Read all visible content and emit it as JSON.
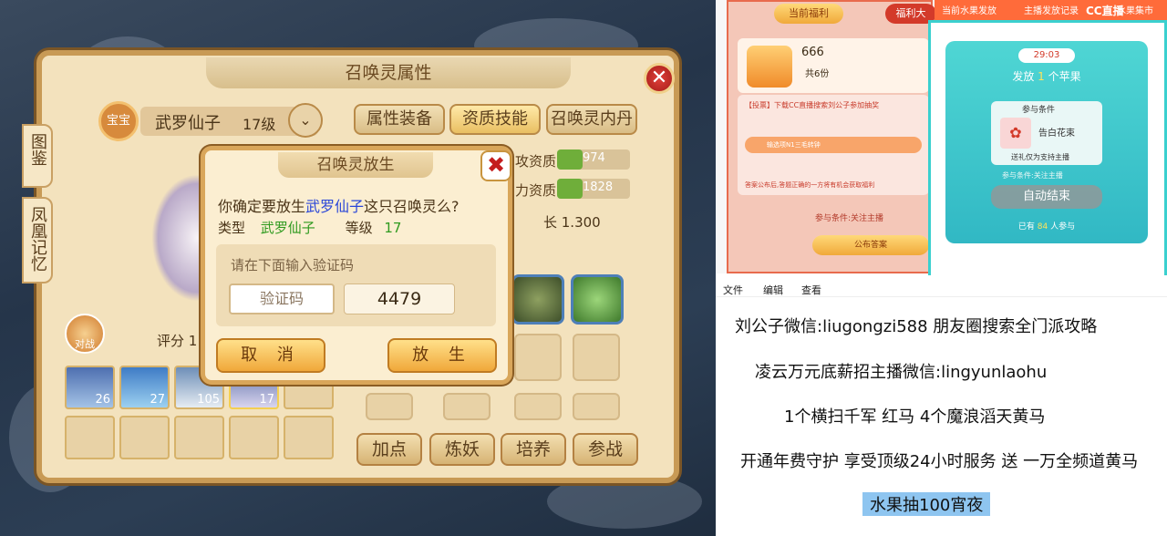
{
  "game": {
    "panel_title": "召唤灵属性",
    "side_tabs": [
      "图鉴",
      "凤凰记忆"
    ],
    "pet_badge": "宝宝",
    "pet_name": "武罗仙子",
    "pet_level": "17级",
    "tabs": [
      "属性装备",
      "资质技能",
      "召唤灵内丹"
    ],
    "stats": [
      {
        "label": "攻资质",
        "value": "974"
      },
      {
        "label": "力资质",
        "value": "1828"
      }
    ],
    "growth": "长 1.300",
    "score_label": "评分 1",
    "pet_slot_levels": [
      "26",
      "27",
      "105",
      "17"
    ],
    "side_icon_label": "对战",
    "bottom_buttons": [
      "加点",
      "炼妖",
      "培养",
      "参战"
    ]
  },
  "dialog": {
    "title": "召唤灵放生",
    "prompt_pre": "你确定要放生",
    "prompt_name": "武罗仙子",
    "prompt_post": "这只召唤灵么?",
    "type_label": "类型",
    "type_value": "武罗仙子",
    "level_label": "等级",
    "level_value": "17",
    "captcha_hint": "请在下面输入验证码",
    "captcha_placeholder": "验证码",
    "captcha_code": "4479",
    "cancel_label": "取 消",
    "release_label": "放 生"
  },
  "stream": {
    "tabs": [
      "当前福利",
      "福利大"
    ],
    "gift_count": "666",
    "gift_total": "共6份",
    "notice": "【投票】下载CC直播搜索刘公子参加抽奖",
    "answer_input": "输选项N1三毛转钟",
    "answer_rule": "答案公布后,答题正确的一方将有机会获取福利",
    "participate_cond": "参与条件:关注主播",
    "publish_btn": "公布答案",
    "right_tabs": [
      "当前水果发放",
      "主播发放记录",
      "水果集市"
    ],
    "logo": "CC直播",
    "timer": "29:03",
    "dispatch_pre": "发放",
    "dispatch_num": "1",
    "dispatch_post": "个苹果",
    "cond_title": "参与条件",
    "gift_name": "告白花束",
    "gift_note": "送礼仅为支持主播",
    "cond_follow": "参与条件:关注主播",
    "auto_end": "自动结束",
    "joined_pre": "已有",
    "joined_num": "84",
    "joined_post": "人参与"
  },
  "notepad": {
    "menu": [
      "文件",
      "编辑",
      "查看"
    ],
    "lines": [
      "刘公子微信:liugongzi588 朋友圈搜索全门派攻略",
      "凌云万元底薪招主播微信:lingyunlaohu",
      "1个横扫千军 红马   4个魔浪滔天黄马",
      "开通年费守护 享受顶级24小时服务 送 一万全频道黄马",
      "水果抽100宵夜"
    ]
  },
  "colors": {
    "accent_gold": "#e9bf62",
    "name_blue": "#2a46d8",
    "value_green": "#2f9a1f",
    "teal": "#3ad0cf",
    "highlight": "#8ec5f0"
  }
}
